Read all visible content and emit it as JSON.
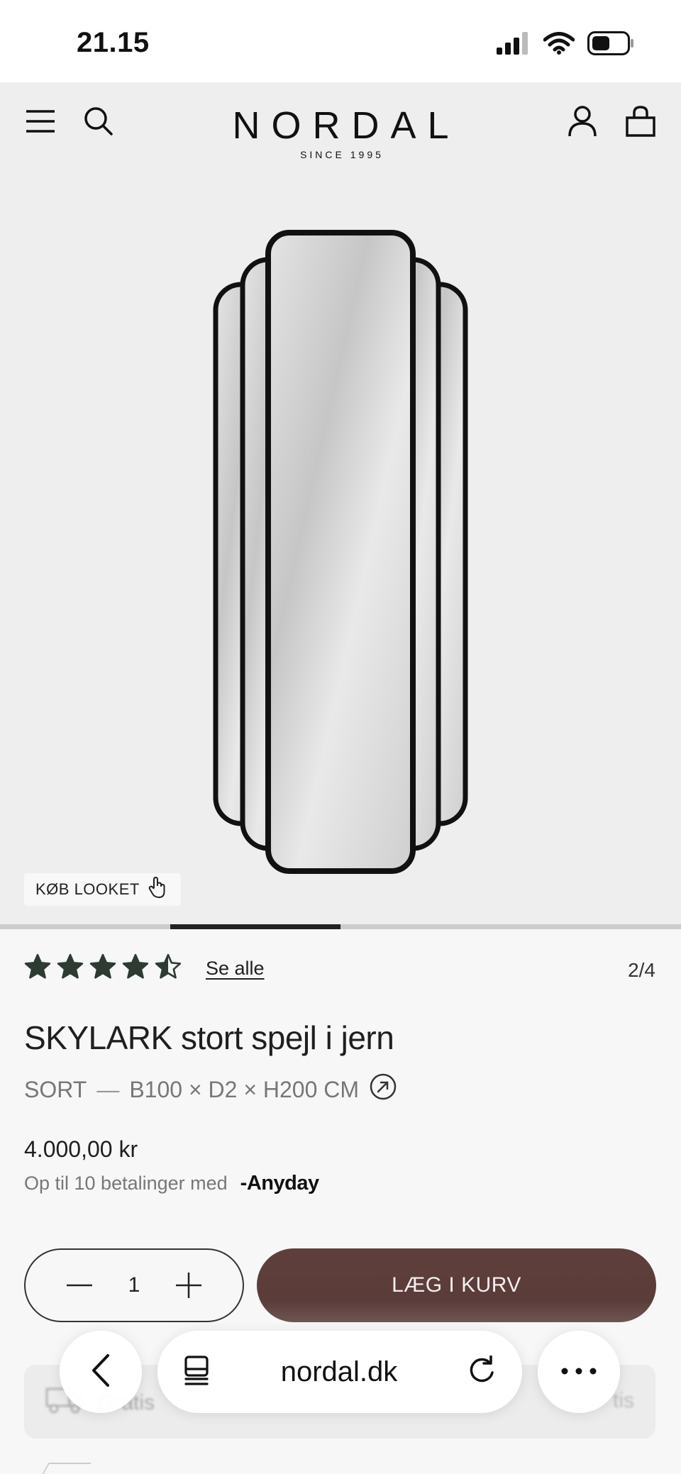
{
  "status_bar": {
    "time": "21.15"
  },
  "header": {
    "brand": "NORDAL",
    "tagline": "SINCE 1995"
  },
  "hero": {
    "shop_look_label": "KØB LOOKET",
    "slide_progress": 0.5
  },
  "product": {
    "rating": 4.5,
    "rating_stars": 5,
    "see_all_label": "Se alle",
    "image_counter": "2/4",
    "title": "SKYLARK stort spejl i jern",
    "color": "SORT",
    "separator": "—",
    "dimensions": "B100 × D2 × H200 CM",
    "price": "4.000,00 kr",
    "payments_text": "Op til 10 betalinger med",
    "payment_provider": "Anyday"
  },
  "cart": {
    "quantity": "1",
    "add_label": "LÆG I KURV"
  },
  "browser": {
    "url": "nordal.dk"
  },
  "behind": {
    "left_text": "Gratis",
    "right_text": "tis"
  },
  "colors": {
    "accent": "#5a3c39",
    "hero_bg": "#eeeeee",
    "star": "#2d3b33"
  }
}
